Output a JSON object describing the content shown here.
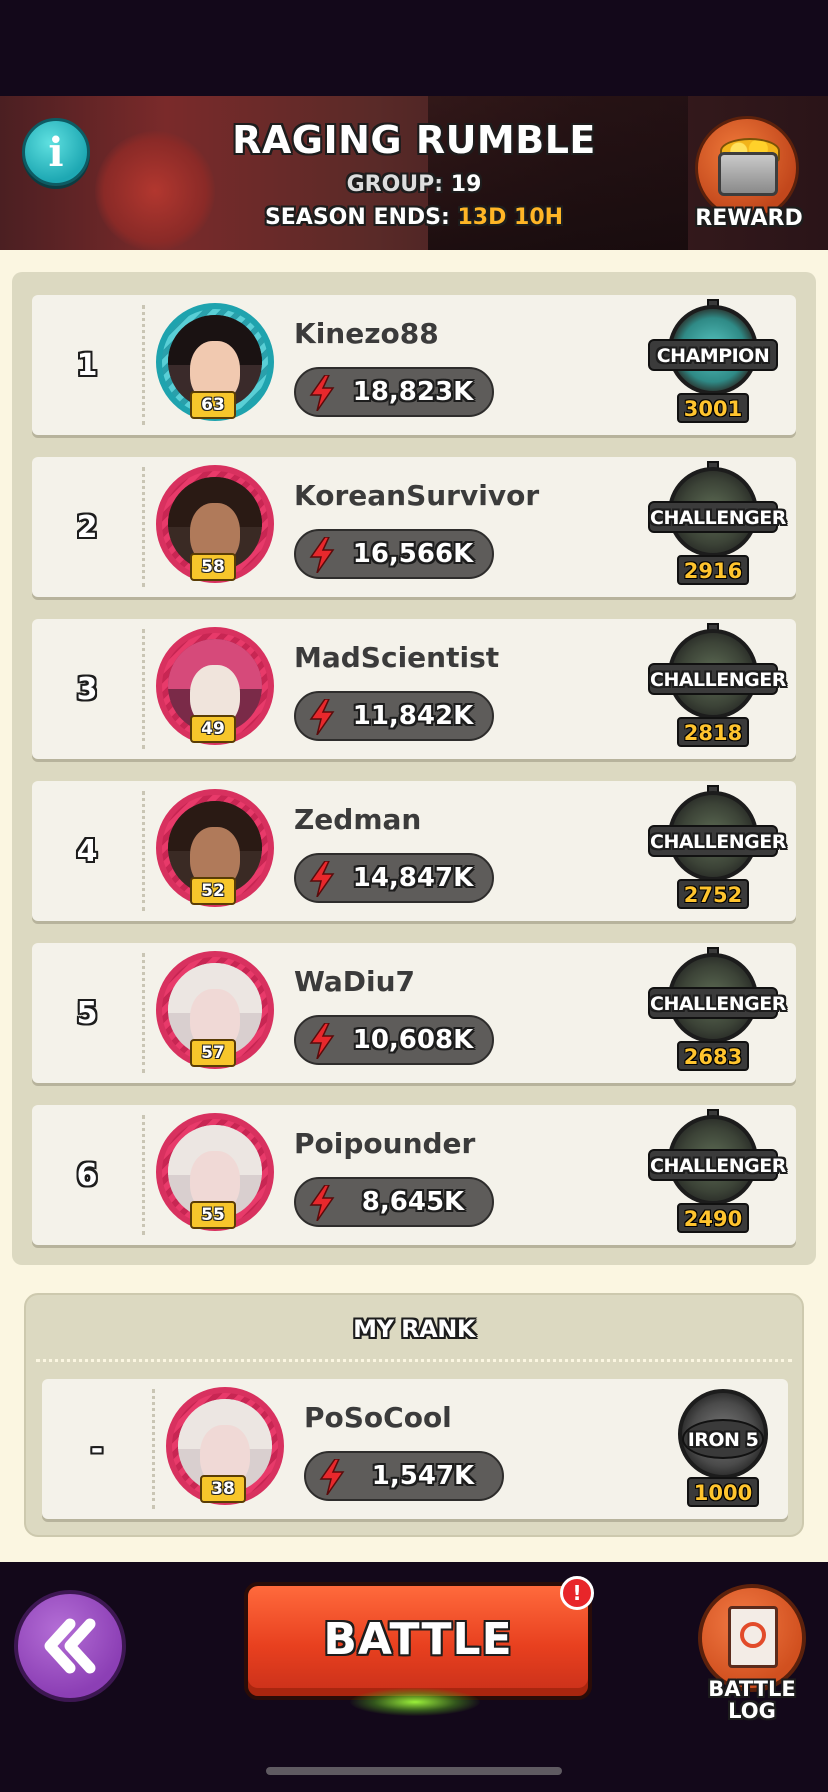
{
  "header": {
    "title": "RAGING RUMBLE",
    "group_label": "GROUP:",
    "group_value": "19",
    "season_label": "SEASON ENDS:",
    "season_value": "13D 10H",
    "reward_label": "REWARD",
    "info_icon": "info-icon"
  },
  "leaderboard": [
    {
      "rank": "1",
      "name": "Kinezo88",
      "level": "63",
      "power": "18,823K",
      "league": "CHAMPION",
      "score": "3001"
    },
    {
      "rank": "2",
      "name": "KoreanSurvivor",
      "level": "58",
      "power": "16,566K",
      "league": "CHALLENGER",
      "score": "2916"
    },
    {
      "rank": "3",
      "name": "MadScientist",
      "level": "49",
      "power": "11,842K",
      "league": "CHALLENGER",
      "score": "2818"
    },
    {
      "rank": "4",
      "name": "Zedman",
      "level": "52",
      "power": "14,847K",
      "league": "CHALLENGER",
      "score": "2752"
    },
    {
      "rank": "5",
      "name": "WaDiu7",
      "level": "57",
      "power": "10,608K",
      "league": "CHALLENGER",
      "score": "2683"
    },
    {
      "rank": "6",
      "name": "Poipounder",
      "level": "55",
      "power": "8,645K",
      "league": "CHALLENGER",
      "score": "2490"
    }
  ],
  "my_rank": {
    "title": "MY RANK",
    "rank": "-",
    "name": "PoSoCool",
    "level": "38",
    "power": "1,547K",
    "league": "IRON 5",
    "score": "1000"
  },
  "bottom_bar": {
    "battle_label": "BATTLE",
    "battle_alert": "!",
    "battle_log_line1": "BATTLE",
    "battle_log_line2": "LOG"
  },
  "colors": {
    "accent_gold": "#ffb526",
    "battle_red": "#e8401f",
    "back_purple": "#8c3fb5",
    "info_teal": "#1ea8b3"
  }
}
